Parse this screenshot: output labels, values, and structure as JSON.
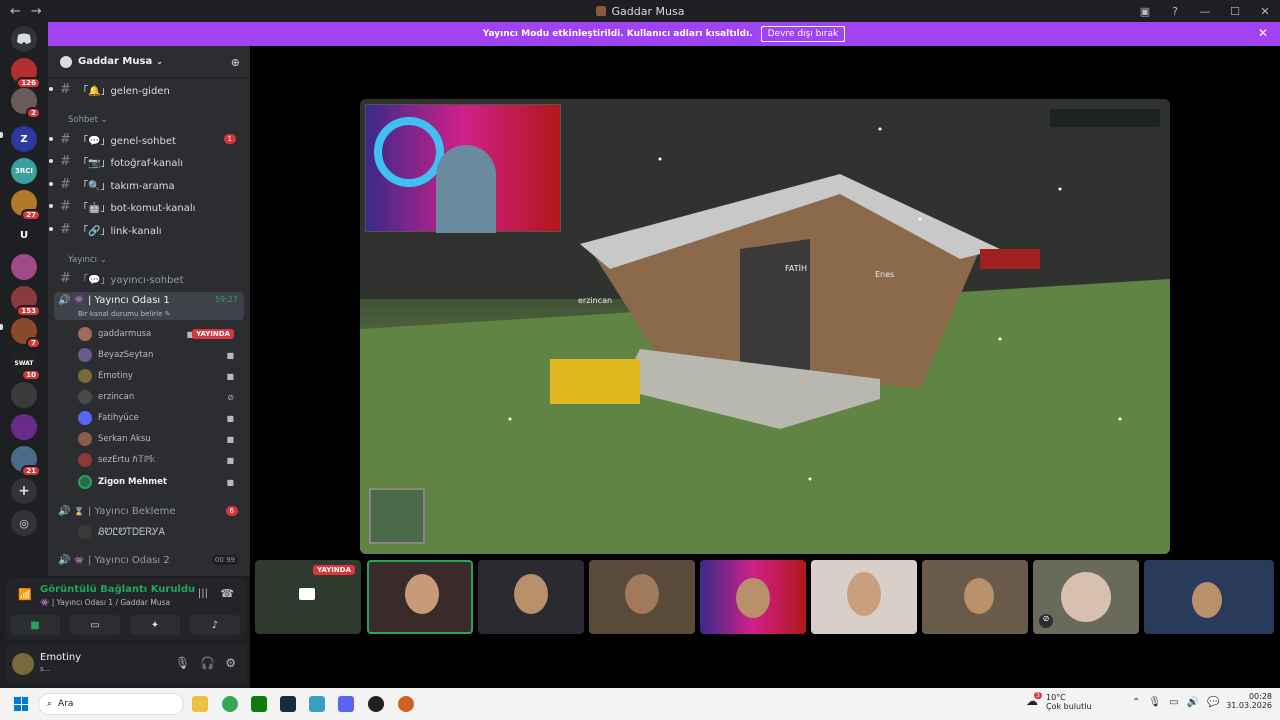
{
  "window": {
    "title": "Gaddar Musa"
  },
  "banner": {
    "text": "Yayıncı Modu etkinleştirildi. Kullanıcı adları kısaltıldı.",
    "button": "Devre dışı bırak"
  },
  "servers": [
    {
      "label": "",
      "badge": "126",
      "color": "#b03030"
    },
    {
      "label": "",
      "badge": "2",
      "color": "#6a5a5a"
    },
    {
      "label": "Z",
      "badge": "",
      "color": "#2a3aa0"
    },
    {
      "label": "3RCI",
      "badge": "",
      "color": "#3aa0a0"
    },
    {
      "label": "",
      "badge": "27",
      "color": "#b07a2a"
    },
    {
      "label": "U",
      "badge": "",
      "color": "#1e1f22"
    },
    {
      "label": "",
      "badge": "",
      "color": "#a04a8a"
    },
    {
      "label": "",
      "badge": "153",
      "color": "#8a3a3a"
    },
    {
      "label": "",
      "badge": "7",
      "color": "#8a4a2a"
    },
    {
      "label": "SWAT",
      "badge": "10",
      "color": "#222222"
    },
    {
      "label": "",
      "badge": "",
      "color": "#3a3a3a"
    },
    {
      "label": "",
      "badge": "",
      "color": "#6a2a8a"
    },
    {
      "label": "",
      "badge": "21",
      "color": "#4a6a8a"
    }
  ],
  "sidebar": {
    "server_name": "Gaddar Musa",
    "channels_top": [
      {
        "label": "「🔔」gelen-giden"
      }
    ],
    "category1": "Sohbet",
    "channels": [
      {
        "label": "「💬」genel-sohbet",
        "badge": "1"
      },
      {
        "label": "「📷」fotoğraf-kanalı",
        "badge": ""
      },
      {
        "label": "「🔍」takım-arama",
        "badge": ""
      },
      {
        "label": "「🤖」bot-komut-kanalı",
        "badge": ""
      },
      {
        "label": "「🔗」link-kanalı",
        "badge": ""
      }
    ],
    "category2": "Yayıncı",
    "yayinci_channel": "「💬」yayıncı-sohbet",
    "voice_room": {
      "label": "| Yayıncı Odası 1",
      "time": "59:27",
      "status": "Bir kanal durumu belirle"
    },
    "users": [
      {
        "name": "gaddarmusa",
        "live": "YAYINDA",
        "color": "#a06a5a"
      },
      {
        "name": "BeyazSeytan",
        "live": "",
        "color": "#6a5a8a"
      },
      {
        "name": "Emotiny",
        "live": "",
        "color": "#7a6a3a"
      },
      {
        "name": "erzincan",
        "live": "",
        "color": "#4a4a4a"
      },
      {
        "name": "Fatihyüce",
        "live": "",
        "color": "#5865f2"
      },
      {
        "name": "Serkan Aksu",
        "live": "",
        "color": "#8a5a4a"
      },
      {
        "name": "sezErtu ℏ𝕋ℙ𝕜",
        "live": "",
        "color": "#8a3a3a"
      },
      {
        "name": "Zigon Mehmet",
        "live": "",
        "color": "#2a6a4a"
      }
    ],
    "bekleme": {
      "label": "| Yayıncı Bekleme",
      "badge": "6",
      "user": "ᏰᏬᏝᏬᎢᎠᎬᏒᎩᎪ"
    },
    "voice_room2": {
      "label": "| Yayıncı Odası 2",
      "c1": "00",
      "c2": "99"
    }
  },
  "voice_panel": {
    "status": "Görüntülü Bağlantı Kuruldu",
    "channel": "| Yayıncı Odası 1 / Gaddar Musa"
  },
  "user_panel": {
    "name": "Emotiny",
    "status": "s..."
  },
  "stage": {
    "live_tag": "YAYINDA",
    "nametag1": "erzincan",
    "nametag2": "FATİH",
    "nametag3": "Enes"
  },
  "tiles": [
    {
      "color": "#2e3a2e"
    },
    {
      "color": "#3a2a2a"
    },
    {
      "color": "#2a2a30"
    },
    {
      "color": "#5a4a3a"
    },
    {
      "color": "#6a2a6a"
    },
    {
      "color": "#d8d0c8"
    },
    {
      "color": "#6a5a4a"
    },
    {
      "color": "#6a6a5a"
    },
    {
      "color": "#2a3a5a"
    }
  ],
  "taskbar": {
    "search": "Ara",
    "temp": "10°C",
    "weather": "Çok bulutlu",
    "time": "00:28",
    "date": "31.03.2026",
    "weather_badge": "3"
  }
}
